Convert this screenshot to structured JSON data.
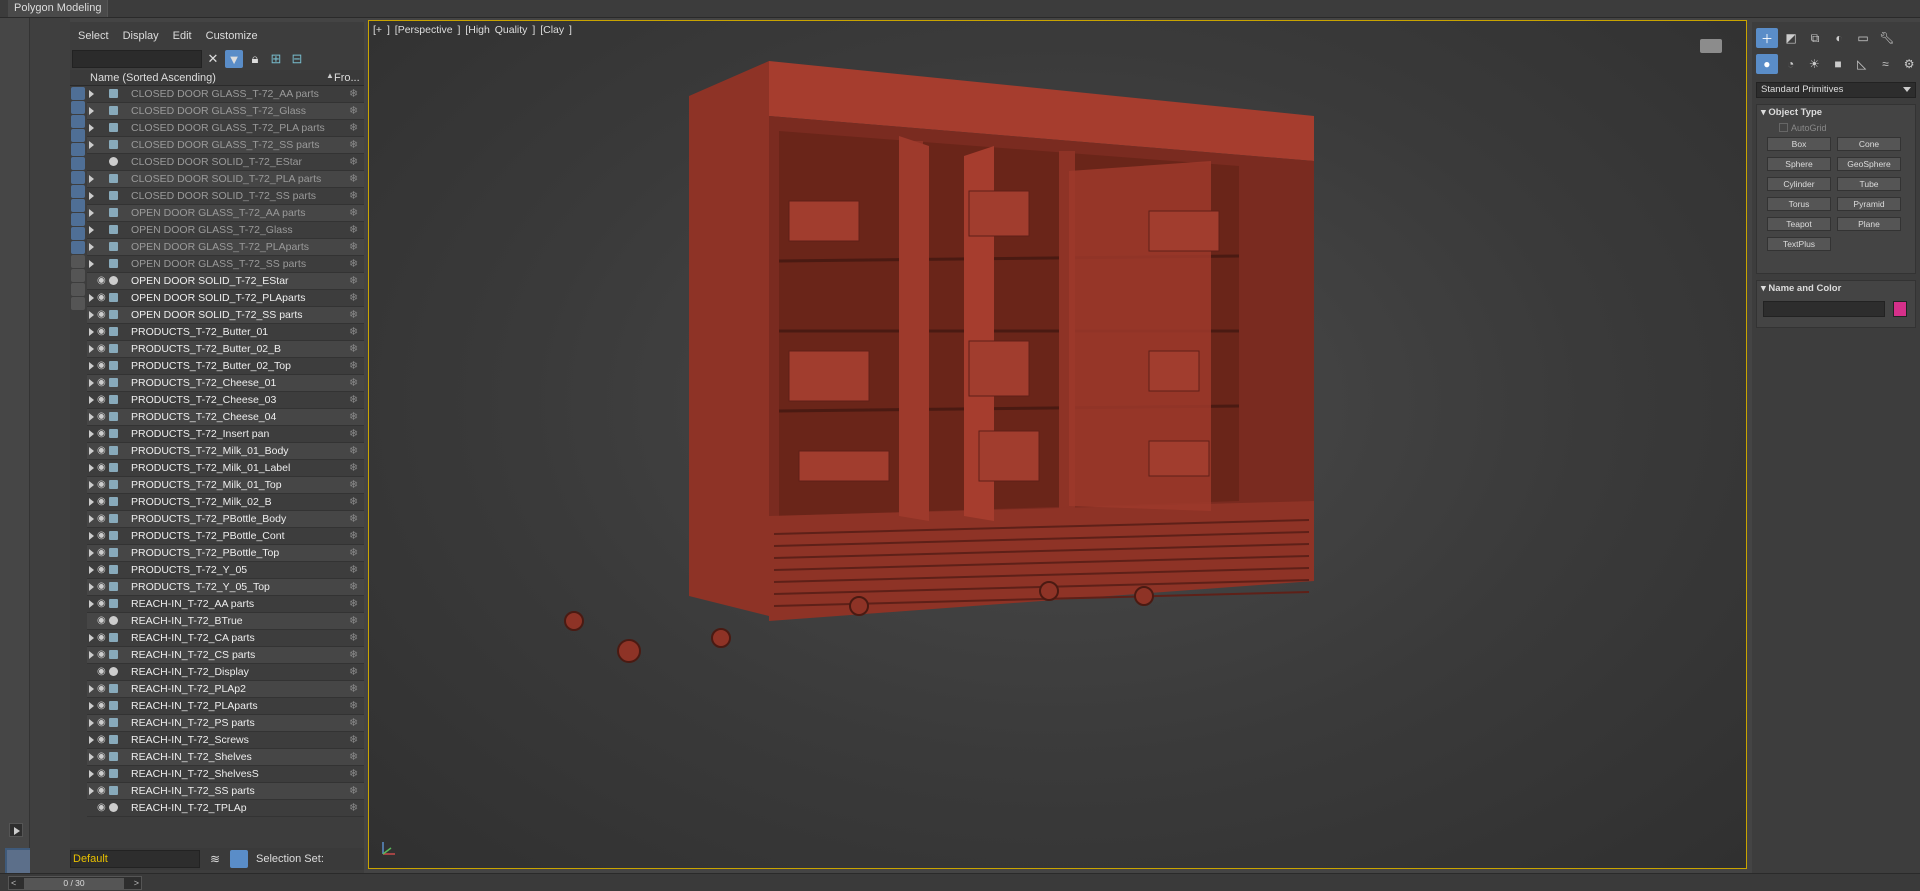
{
  "ribbon": {
    "tab_label": "Polygon Modeling"
  },
  "explorer": {
    "menu": [
      "Select",
      "Display",
      "Edit",
      "Customize"
    ],
    "columns": {
      "name": "Name (Sorted Ascending)",
      "frozen": "Fro..."
    },
    "rows": [
      {
        "label": "CLOSED DOOR GLASS_T-72_AA parts",
        "dim": true,
        "expand": true,
        "eye": false,
        "group": true
      },
      {
        "label": "CLOSED DOOR GLASS_T-72_Glass",
        "dim": true,
        "expand": true,
        "eye": false,
        "group": true
      },
      {
        "label": "CLOSED DOOR GLASS_T-72_PLA parts",
        "dim": true,
        "expand": true,
        "eye": false,
        "group": true
      },
      {
        "label": "CLOSED DOOR GLASS_T-72_SS parts",
        "dim": true,
        "expand": true,
        "eye": false,
        "group": true
      },
      {
        "label": "CLOSED DOOR SOLID_T-72_EStar",
        "dim": true,
        "expand": false,
        "eye": false,
        "group": false
      },
      {
        "label": "CLOSED DOOR SOLID_T-72_PLA parts",
        "dim": true,
        "expand": true,
        "eye": false,
        "group": true
      },
      {
        "label": "CLOSED DOOR SOLID_T-72_SS parts",
        "dim": true,
        "expand": true,
        "eye": false,
        "group": true
      },
      {
        "label": "OPEN DOOR GLASS_T-72_AA parts",
        "dim": true,
        "expand": true,
        "eye": false,
        "group": true
      },
      {
        "label": "OPEN DOOR GLASS_T-72_Glass",
        "dim": true,
        "expand": true,
        "eye": false,
        "group": true
      },
      {
        "label": "OPEN DOOR GLASS_T-72_PLAparts",
        "dim": true,
        "expand": true,
        "eye": false,
        "group": true
      },
      {
        "label": "OPEN DOOR GLASS_T-72_SS parts",
        "dim": true,
        "expand": true,
        "eye": false,
        "group": true
      },
      {
        "label": "OPEN DOOR SOLID_T-72_EStar",
        "dim": false,
        "expand": false,
        "eye": true,
        "group": false
      },
      {
        "label": "OPEN DOOR SOLID_T-72_PLAparts",
        "dim": false,
        "expand": true,
        "eye": true,
        "group": true
      },
      {
        "label": "OPEN DOOR SOLID_T-72_SS parts",
        "dim": false,
        "expand": true,
        "eye": true,
        "group": true
      },
      {
        "label": "PRODUCTS_T-72_Butter_01",
        "dim": false,
        "expand": true,
        "eye": true,
        "group": true
      },
      {
        "label": "PRODUCTS_T-72_Butter_02_B",
        "dim": false,
        "expand": true,
        "eye": true,
        "group": true
      },
      {
        "label": "PRODUCTS_T-72_Butter_02_Top",
        "dim": false,
        "expand": true,
        "eye": true,
        "group": true
      },
      {
        "label": "PRODUCTS_T-72_Cheese_01",
        "dim": false,
        "expand": true,
        "eye": true,
        "group": true
      },
      {
        "label": "PRODUCTS_T-72_Cheese_03",
        "dim": false,
        "expand": true,
        "eye": true,
        "group": true
      },
      {
        "label": "PRODUCTS_T-72_Cheese_04",
        "dim": false,
        "expand": true,
        "eye": true,
        "group": true
      },
      {
        "label": "PRODUCTS_T-72_Insert pan",
        "dim": false,
        "expand": true,
        "eye": true,
        "group": true
      },
      {
        "label": "PRODUCTS_T-72_Milk_01_Body",
        "dim": false,
        "expand": true,
        "eye": true,
        "group": true
      },
      {
        "label": "PRODUCTS_T-72_Milk_01_Label",
        "dim": false,
        "expand": true,
        "eye": true,
        "group": true
      },
      {
        "label": "PRODUCTS_T-72_Milk_01_Top",
        "dim": false,
        "expand": true,
        "eye": true,
        "group": true
      },
      {
        "label": "PRODUCTS_T-72_Milk_02_B",
        "dim": false,
        "expand": true,
        "eye": true,
        "group": true
      },
      {
        "label": "PRODUCTS_T-72_PBottle_Body",
        "dim": false,
        "expand": true,
        "eye": true,
        "group": true
      },
      {
        "label": "PRODUCTS_T-72_PBottle_Cont",
        "dim": false,
        "expand": true,
        "eye": true,
        "group": true
      },
      {
        "label": "PRODUCTS_T-72_PBottle_Top",
        "dim": false,
        "expand": true,
        "eye": true,
        "group": true
      },
      {
        "label": "PRODUCTS_T-72_Y_05",
        "dim": false,
        "expand": true,
        "eye": true,
        "group": true
      },
      {
        "label": "PRODUCTS_T-72_Y_05_Top",
        "dim": false,
        "expand": true,
        "eye": true,
        "group": true
      },
      {
        "label": "REACH-IN_T-72_AA parts",
        "dim": false,
        "expand": true,
        "eye": true,
        "group": true
      },
      {
        "label": "REACH-IN_T-72_BTrue",
        "dim": false,
        "expand": false,
        "eye": true,
        "group": false
      },
      {
        "label": "REACH-IN_T-72_CA parts",
        "dim": false,
        "expand": true,
        "eye": true,
        "group": true
      },
      {
        "label": "REACH-IN_T-72_CS parts",
        "dim": false,
        "expand": true,
        "eye": true,
        "group": true
      },
      {
        "label": "REACH-IN_T-72_Display",
        "dim": false,
        "expand": false,
        "eye": true,
        "group": false
      },
      {
        "label": "REACH-IN_T-72_PLAp2",
        "dim": false,
        "expand": true,
        "eye": true,
        "group": true
      },
      {
        "label": "REACH-IN_T-72_PLAparts",
        "dim": false,
        "expand": true,
        "eye": true,
        "group": true
      },
      {
        "label": "REACH-IN_T-72_PS parts",
        "dim": false,
        "expand": true,
        "eye": true,
        "group": true
      },
      {
        "label": "REACH-IN_T-72_Screws",
        "dim": false,
        "expand": true,
        "eye": true,
        "group": true
      },
      {
        "label": "REACH-IN_T-72_Shelves",
        "dim": false,
        "expand": true,
        "eye": true,
        "group": true
      },
      {
        "label": "REACH-IN_T-72_ShelvesS",
        "dim": false,
        "expand": true,
        "eye": true,
        "group": true
      },
      {
        "label": "REACH-IN_T-72_SS parts",
        "dim": false,
        "expand": true,
        "eye": true,
        "group": true
      },
      {
        "label": "REACH-IN_T-72_TPLAp",
        "dim": false,
        "expand": false,
        "eye": true,
        "group": false
      }
    ],
    "layer_value": "Default",
    "selection_set_label": "Selection Set:"
  },
  "viewport": {
    "label": "[+ ]  [Perspective ]  [High Quality ]  [Clay ]",
    "model_color": "#9e3a2c"
  },
  "command_panel": {
    "dropdown_value": "Standard Primitives",
    "object_type_title": "Object Type",
    "autogrid_label": "AutoGrid",
    "primitives": [
      "Box",
      "Cone",
      "Sphere",
      "GeoSphere",
      "Cylinder",
      "Tube",
      "Torus",
      "Pyramid",
      "Teapot",
      "Plane",
      "TextPlus"
    ],
    "name_color_title": "Name and Color",
    "name_value": "",
    "swatch_color": "#d6308a"
  },
  "status": {
    "time_label": "0 / 30"
  }
}
